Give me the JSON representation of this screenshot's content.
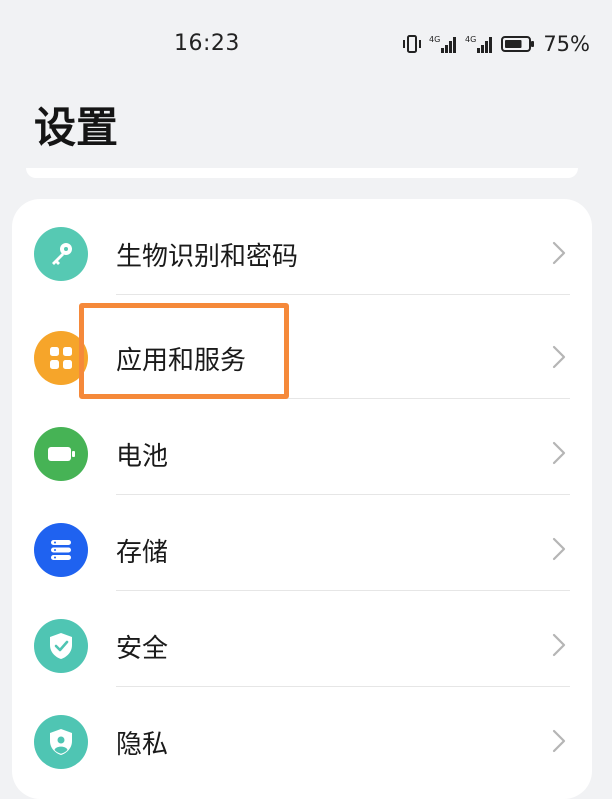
{
  "status_bar": {
    "time": "16:23",
    "battery_percent": "75%",
    "signal_1_label": "4G",
    "signal_2_label": "4G",
    "battery_level": 0.75
  },
  "header": {
    "title": "设置"
  },
  "settings": {
    "items": [
      {
        "label": "生物识别和密码",
        "icon": "key-icon",
        "color": "#56c9b3"
      },
      {
        "label": "应用和服务",
        "icon": "apps-grid-icon",
        "color": "#f6a52a"
      },
      {
        "label": "电池",
        "icon": "battery-icon",
        "color": "#46b355"
      },
      {
        "label": "存储",
        "icon": "storage-icon",
        "color": "#1f62f0"
      },
      {
        "label": "安全",
        "icon": "shield-check-icon",
        "color": "#4fc5b3"
      },
      {
        "label": "隐私",
        "icon": "privacy-shield-icon",
        "color": "#4fc5b3"
      }
    ],
    "highlighted_index": 1,
    "highlight_color": "#f5893a"
  }
}
